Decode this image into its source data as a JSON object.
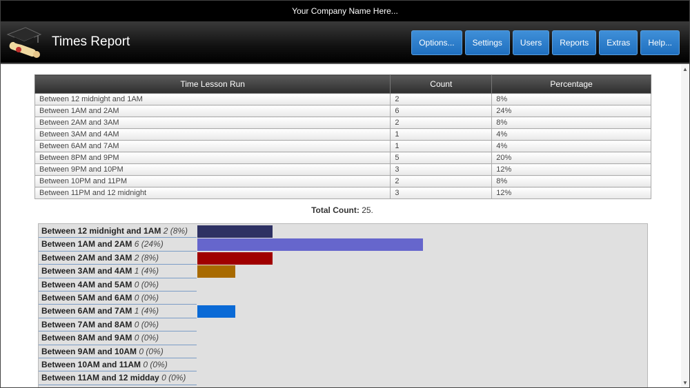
{
  "company": "Your Company Name Here...",
  "title": "Times Report",
  "nav": [
    "Options...",
    "Settings",
    "Users",
    "Reports",
    "Extras",
    "Help..."
  ],
  "table": {
    "headers": [
      "Time Lesson Run",
      "Count",
      "Percentage"
    ],
    "rows": [
      [
        "Between 12 midnight and 1AM",
        "2",
        "8%"
      ],
      [
        "Between 1AM and 2AM",
        "6",
        "24%"
      ],
      [
        "Between 2AM and 3AM",
        "2",
        "8%"
      ],
      [
        "Between 3AM and 4AM",
        "1",
        "4%"
      ],
      [
        "Between 6AM and 7AM",
        "1",
        "4%"
      ],
      [
        "Between 8PM and 9PM",
        "5",
        "20%"
      ],
      [
        "Between 9PM and 10PM",
        "3",
        "12%"
      ],
      [
        "Between 10PM and 11PM",
        "2",
        "8%"
      ],
      [
        "Between 11PM and 12 midnight",
        "3",
        "12%"
      ]
    ]
  },
  "total": {
    "label": "Total Count:",
    "value": "25."
  },
  "chart_data": {
    "type": "bar",
    "categories": [
      "Between 12 midnight and 1AM",
      "Between 1AM and 2AM",
      "Between 2AM and 3AM",
      "Between 3AM and 4AM",
      "Between 4AM and 5AM",
      "Between 5AM and 6AM",
      "Between 6AM and 7AM",
      "Between 7AM and 8AM",
      "Between 8AM and 9AM",
      "Between 9AM and 10AM",
      "Between 10AM and 11AM",
      "Between 11AM and 12 midday"
    ],
    "values": [
      2,
      6,
      2,
      1,
      0,
      0,
      1,
      0,
      0,
      0,
      0,
      0
    ],
    "value_labels": [
      "2 (8%)",
      "6 (24%)",
      "2 (8%)",
      "1 (4%)",
      "0 (0%)",
      "0 (0%)",
      "1 (4%)",
      "0 (0%)",
      "0 (0%)",
      "0 (0%)",
      "0 (0%)",
      "0 (0%)"
    ],
    "colors": [
      "#2e3163",
      "#6666cc",
      "#a00000",
      "#a86a00",
      "#888888",
      "#888888",
      "#0a6ad6",
      "#888888",
      "#888888",
      "#888888",
      "#888888",
      "#888888"
    ],
    "xlim": [
      0,
      100
    ]
  }
}
